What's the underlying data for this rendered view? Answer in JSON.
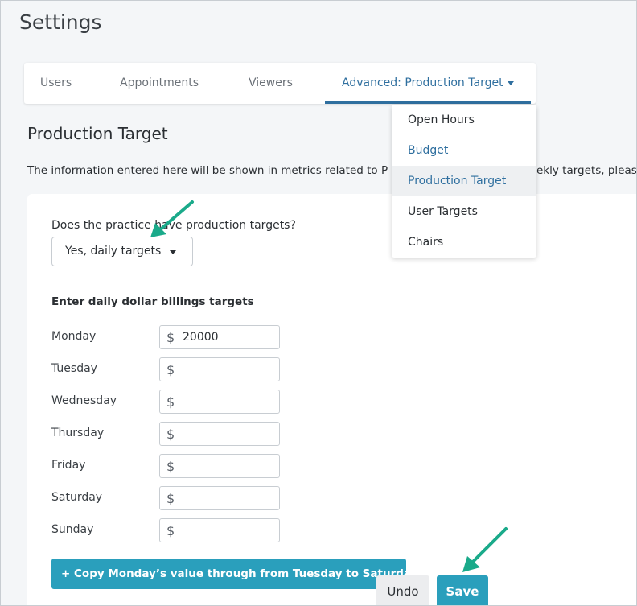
{
  "page": {
    "title": "Settings"
  },
  "tabs": [
    {
      "label": "Users"
    },
    {
      "label": "Appointments"
    },
    {
      "label": "Viewers"
    },
    {
      "label": "Advanced: Production Target"
    }
  ],
  "dropdown": {
    "items": [
      {
        "label": "Open Hours"
      },
      {
        "label": "Budget"
      },
      {
        "label": "Production Target"
      },
      {
        "label": "User Targets"
      },
      {
        "label": "Chairs"
      }
    ],
    "selected": "Production Target"
  },
  "section": {
    "title": "Production Target",
    "info_left": "The information entered here will be shown in metrics related to P",
    "info_right": "ekly targets, pleas"
  },
  "targets": {
    "question": "Does the practice have production targets?",
    "select_value": "Yes, daily targets",
    "subheading": "Enter daily dollar billings targets",
    "currency_symbol": "$",
    "days": [
      {
        "label": "Monday",
        "value": "20000"
      },
      {
        "label": "Tuesday",
        "value": ""
      },
      {
        "label": "Wednesday",
        "value": ""
      },
      {
        "label": "Thursday",
        "value": ""
      },
      {
        "label": "Friday",
        "value": ""
      },
      {
        "label": "Saturday",
        "value": ""
      },
      {
        "label": "Sunday",
        "value": ""
      }
    ]
  },
  "actions": {
    "copy_label": "+  Copy Monday’s value through from Tuesday to Saturday",
    "undo_label": "Undo",
    "save_label": "Save"
  },
  "colors": {
    "accent": "#2a9fbc",
    "link": "#2f6f9f",
    "annotation_arrow": "#1aaa8a"
  }
}
